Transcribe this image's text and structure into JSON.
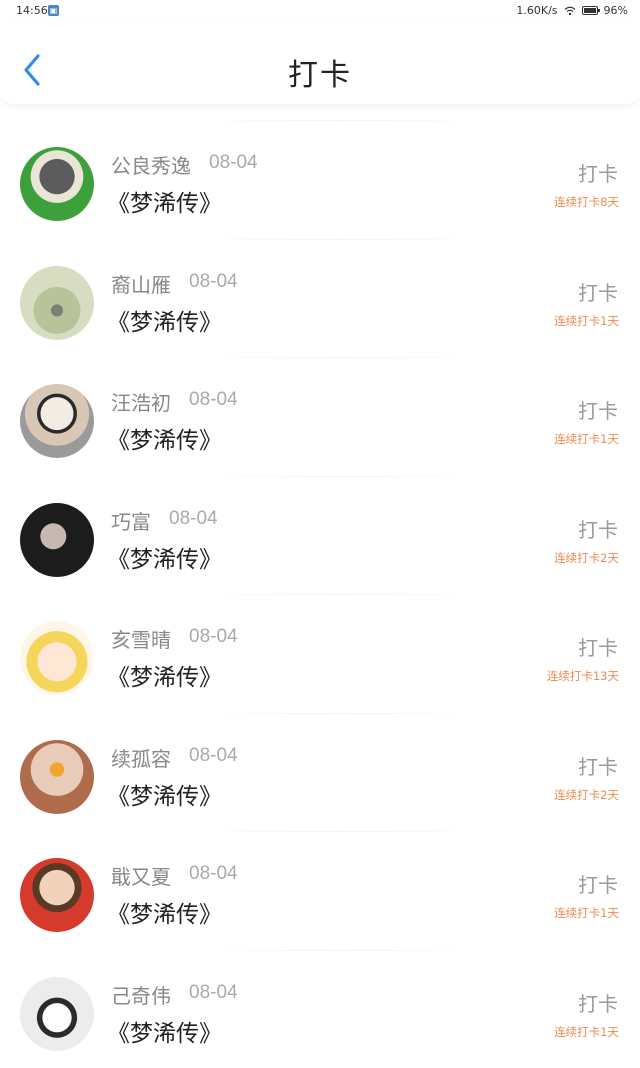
{
  "status_bar": {
    "time": "14:56",
    "network_speed": "1.60K/s",
    "battery": "96%"
  },
  "header": {
    "title": "打卡",
    "back_icon": "chevron-left-icon",
    "accent_color": "#2f8ee6"
  },
  "items": [
    {
      "name": "公良秀逸",
      "date": "08-04",
      "book": "《梦浠传》",
      "action": "打卡",
      "streak": "连续打卡8天"
    },
    {
      "name": "裔山雁",
      "date": "08-04",
      "book": "《梦浠传》",
      "action": "打卡",
      "streak": "连续打卡1天"
    },
    {
      "name": "汪浩初",
      "date": "08-04",
      "book": "《梦浠传》",
      "action": "打卡",
      "streak": "连续打卡1天"
    },
    {
      "name": "巧富",
      "date": "08-04",
      "book": "《梦浠传》",
      "action": "打卡",
      "streak": "连续打卡2天"
    },
    {
      "name": "亥雪晴",
      "date": "08-04",
      "book": "《梦浠传》",
      "action": "打卡",
      "streak": "连续打卡13天"
    },
    {
      "name": "续孤容",
      "date": "08-04",
      "book": "《梦浠传》",
      "action": "打卡",
      "streak": "连续打卡2天"
    },
    {
      "name": "戢又夏",
      "date": "08-04",
      "book": "《梦浠传》",
      "action": "打卡",
      "streak": "连续打卡1天"
    },
    {
      "name": "己奇伟",
      "date": "08-04",
      "book": "《梦浠传》",
      "action": "打卡",
      "streak": "连续打卡1天"
    }
  ],
  "colors": {
    "streak": "#ee8a52",
    "muted_text": "#888888"
  }
}
